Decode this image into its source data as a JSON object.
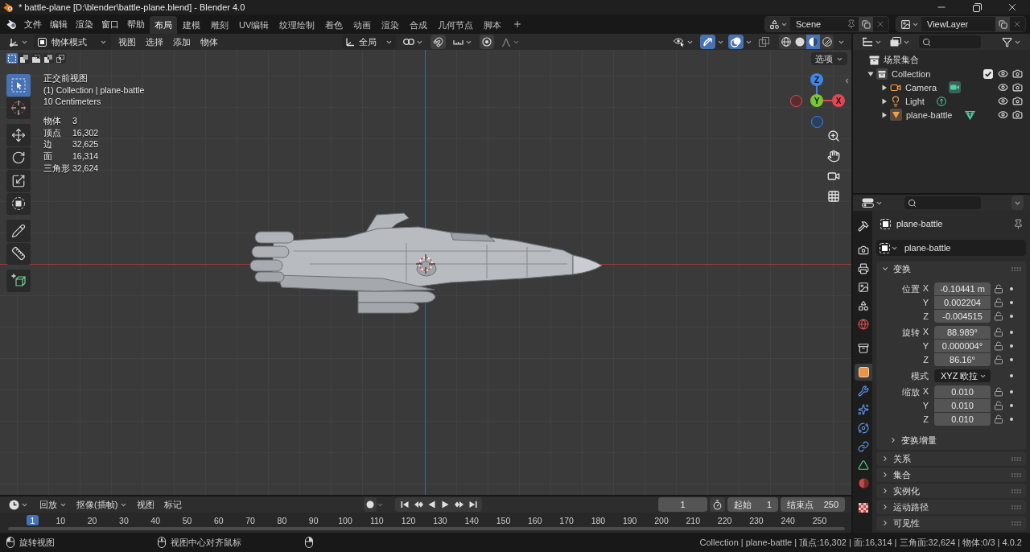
{
  "window": {
    "title": "* battle-plane [D:\\blender\\battle-plane.blend] - Blender 4.0"
  },
  "menu": [
    "文件",
    "编辑",
    "渲染",
    "窗口",
    "帮助"
  ],
  "workspaces": [
    {
      "label": "布局",
      "selected": true
    },
    {
      "label": "建模",
      "selected": false
    },
    {
      "label": "雕刻",
      "selected": false
    },
    {
      "label": "UV编辑",
      "selected": false
    },
    {
      "label": "纹理绘制",
      "selected": false
    },
    {
      "label": "着色",
      "selected": false
    },
    {
      "label": "动画",
      "selected": false
    },
    {
      "label": "渲染",
      "selected": false
    },
    {
      "label": "合成",
      "selected": false
    },
    {
      "label": "几何节点",
      "selected": false
    },
    {
      "label": "脚本",
      "selected": false
    }
  ],
  "scene": "Scene",
  "view_layer": "ViewLayer",
  "viewport": {
    "mode": "物体模式",
    "menus": [
      "视图",
      "选择",
      "添加",
      "物体"
    ],
    "orientation": "全局",
    "toggles": [
      {
        "kind": "gizmo",
        "on": true
      },
      {
        "kind": "overlay",
        "on": true
      },
      {
        "kind": "xray",
        "on": false
      }
    ],
    "shading": [
      {
        "kind": "wireframe",
        "selected": false
      },
      {
        "kind": "solid",
        "selected": false
      },
      {
        "kind": "material",
        "selected": true
      },
      {
        "kind": "rendered",
        "selected": false
      }
    ],
    "options": "选项",
    "select_modes": [
      {
        "kind": "new",
        "selected": true
      },
      {
        "kind": "extend",
        "selected": false
      },
      {
        "kind": "subtract",
        "selected": false
      },
      {
        "kind": "invert",
        "selected": false
      },
      {
        "kind": "intersect",
        "selected": false
      }
    ],
    "tool_groups": [
      {
        "tools": [
          {
            "kind": "select",
            "selected": true
          },
          {
            "kind": "cursor",
            "selected": false
          }
        ]
      },
      {
        "tools": [
          {
            "kind": "move",
            "selected": false
          },
          {
            "kind": "rotate",
            "selected": false
          },
          {
            "kind": "scale",
            "selected": false
          },
          {
            "kind": "transform",
            "selected": false
          }
        ]
      },
      {
        "tools": [
          {
            "kind": "annotate",
            "selected": false
          },
          {
            "kind": "measure",
            "selected": false
          }
        ]
      },
      {
        "tools": [
          {
            "kind": "add_cube",
            "selected": false
          }
        ]
      }
    ],
    "info": {
      "view": "正交前视图",
      "context": "(1) Collection | plane-battle",
      "scale": "10 Centimeters",
      "stats": [
        {
          "label": "物体",
          "value": "3"
        },
        {
          "label": "顶点",
          "value": "16,302"
        },
        {
          "label": "边",
          "value": "32,625"
        },
        {
          "label": "面",
          "value": "16,314"
        },
        {
          "label": "三角形",
          "value": "32,624"
        }
      ]
    },
    "gizmo_axes": [
      {
        "kind": "negx"
      },
      {
        "kind": "negz"
      },
      {
        "kind": "z",
        "label": "Z"
      },
      {
        "kind": "x",
        "label": "X"
      },
      {
        "kind": "y",
        "label": "Y"
      }
    ]
  },
  "outliner": {
    "root": "场景集合",
    "items": [
      {
        "label": "Collection",
        "kind": "collection",
        "expanded": true,
        "checked": true,
        "visible": true,
        "renderable": true,
        "children": [
          {
            "label": "Camera",
            "kind": "camera",
            "expanded": false,
            "visible": true,
            "renderable": true
          },
          {
            "label": "Light",
            "kind": "light",
            "expanded": false,
            "visible": true,
            "renderable": true
          },
          {
            "label": "plane-battle",
            "kind": "mesh",
            "expanded": false,
            "visible": true,
            "renderable": true
          }
        ]
      }
    ]
  },
  "properties": {
    "tab_groups": [
      {
        "tabs": [
          {
            "kind": "tool",
            "selected": false
          }
        ]
      },
      {
        "tabs": [
          {
            "kind": "render",
            "selected": false
          },
          {
            "kind": "output",
            "selected": false
          },
          {
            "kind": "view_layer",
            "selected": false
          },
          {
            "kind": "scene",
            "selected": false
          },
          {
            "kind": "world",
            "selected": false
          }
        ]
      },
      {
        "tabs": [
          {
            "kind": "collection",
            "selected": false
          }
        ]
      },
      {
        "tabs": [
          {
            "kind": "object",
            "selected": true
          },
          {
            "kind": "modifiers",
            "selected": false
          },
          {
            "kind": "particles",
            "selected": false
          },
          {
            "kind": "physics",
            "selected": false
          },
          {
            "kind": "constraints",
            "selected": false
          },
          {
            "kind": "data",
            "selected": false
          },
          {
            "kind": "material",
            "selected": false
          }
        ]
      },
      {
        "tabs": [
          {
            "kind": "texture",
            "selected": false
          }
        ]
      }
    ],
    "object": "plane-battle",
    "datablock": "plane-battle",
    "panels": [
      {
        "title": "变换",
        "expanded": true,
        "groups": [
          {
            "kind": "vector",
            "label": "位置",
            "rows": [
              {
                "axis": "X",
                "value": "-0.10441 m",
                "locked": false
              },
              {
                "axis": "Y",
                "value": "0.002204",
                "locked": false
              },
              {
                "axis": "Z",
                "value": "-0.004515",
                "locked": false
              }
            ]
          },
          {
            "kind": "vector",
            "label": "旋转",
            "rows": [
              {
                "axis": "X",
                "value": "88.989°",
                "locked": false
              },
              {
                "axis": "Y",
                "value": "0.000004°",
                "locked": false
              },
              {
                "axis": "Z",
                "value": "86.16°",
                "locked": false
              }
            ]
          },
          {
            "kind": "dropdown",
            "label": "模式",
            "value": "XYZ 欧拉"
          },
          {
            "kind": "vector",
            "label": "缩放",
            "rows": [
              {
                "axis": "X",
                "value": "0.010",
                "locked": false
              },
              {
                "axis": "Y",
                "value": "0.010",
                "locked": false
              },
              {
                "axis": "Z",
                "value": "0.010",
                "locked": false
              }
            ]
          }
        ],
        "subpanels": [
          {
            "title": "变换增量",
            "expanded": false
          }
        ]
      },
      {
        "title": "关系",
        "expanded": false
      },
      {
        "title": "集合",
        "expanded": false
      },
      {
        "title": "实例化",
        "expanded": false
      },
      {
        "title": "运动路径",
        "expanded": false
      },
      {
        "title": "可见性",
        "expanded": false
      }
    ]
  },
  "timeline": {
    "menus": [
      {
        "label": "回放",
        "dropdown": true
      },
      {
        "label": "抠像(插帧)",
        "dropdown": true
      },
      {
        "label": "视图",
        "dropdown": false
      },
      {
        "label": "标记",
        "dropdown": false
      }
    ],
    "current_frame": "1",
    "start": {
      "label": "起始",
      "value": "1"
    },
    "end": {
      "label": "结束点",
      "value": "250"
    },
    "playhead": "1",
    "ruler": [
      "10",
      "20",
      "30",
      "40",
      "50",
      "60",
      "70",
      "80",
      "90",
      "100",
      "110",
      "120",
      "130",
      "140",
      "150",
      "160",
      "170",
      "180",
      "190",
      "200",
      "210",
      "220",
      "230",
      "240",
      "250"
    ]
  },
  "status_bar": {
    "hints": [
      {
        "kind": "left",
        "label": "旋转视图"
      },
      {
        "kind": "middle",
        "label": "视图中心对齐鼠标"
      },
      {
        "kind": "right"
      }
    ],
    "info": "Collection | plane-battle | 顶点:16,302 | 面:16,314 | 三角面:32,624 | 物体:0/3 | 4.0.2"
  }
}
